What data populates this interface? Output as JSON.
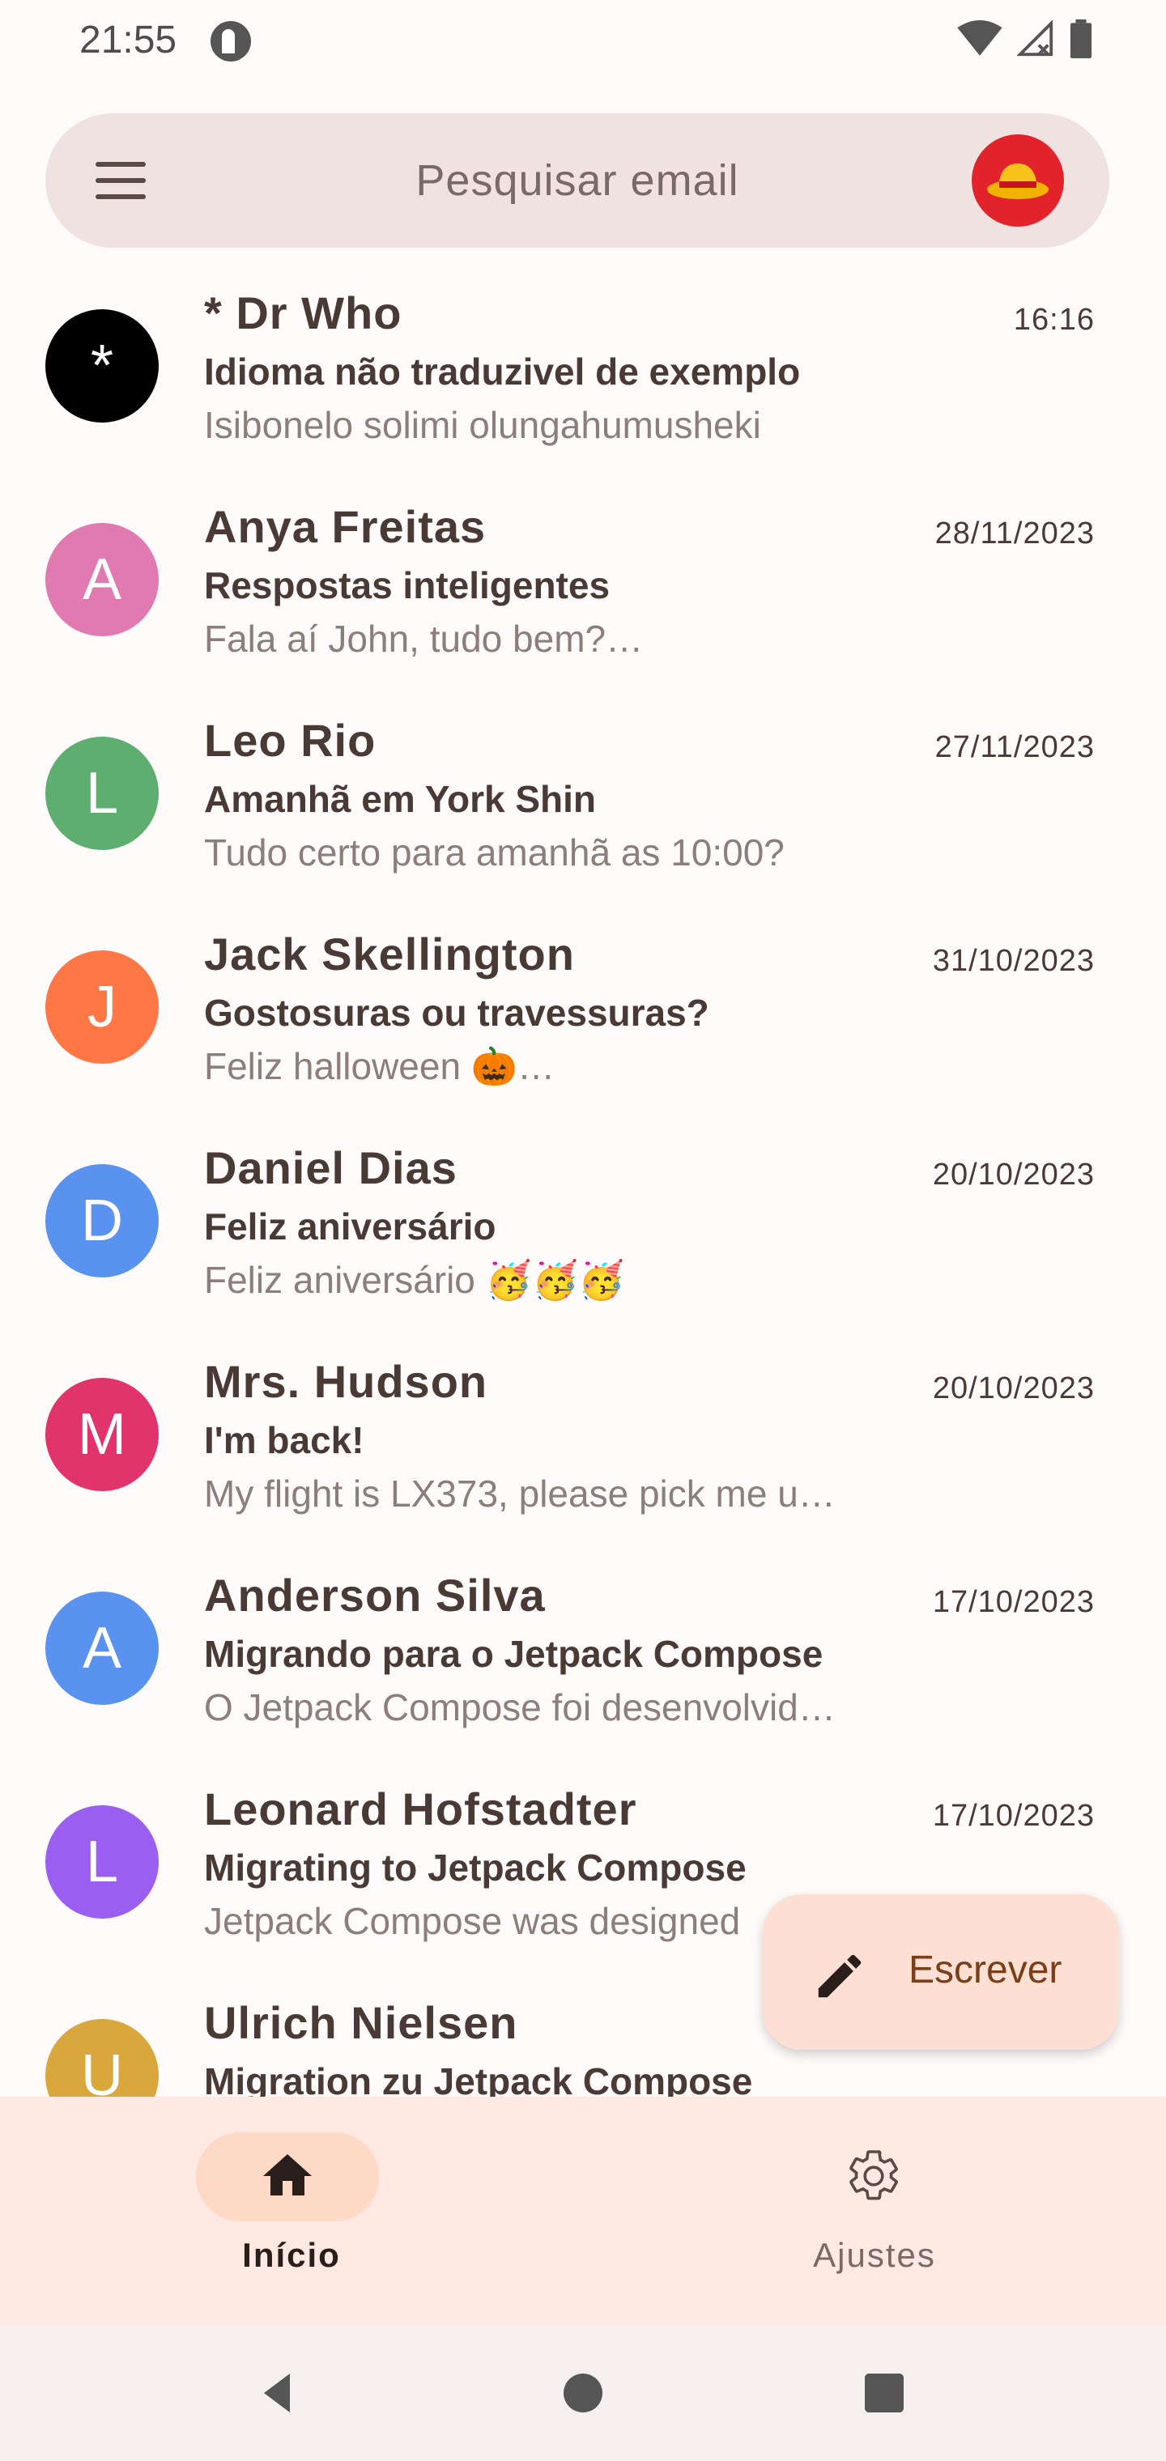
{
  "status": {
    "time": "21:55"
  },
  "search": {
    "placeholder": "Pesquisar email"
  },
  "emails": [
    {
      "sender": "* Dr Who",
      "date": "16:16",
      "subject": "Idioma não traduzivel de exemplo",
      "preview": "Isibonelo solimi olungahumusheki",
      "initial": "*",
      "color": "#000000"
    },
    {
      "sender": "Anya Freitas",
      "date": "28/11/2023",
      "subject": "Respostas inteligentes",
      "preview": "Fala aí John, tudo bem?…",
      "initial": "A",
      "color": "#e27ab2"
    },
    {
      "sender": "Leo Rio",
      "date": "27/11/2023",
      "subject": "Amanhã em York Shin",
      "preview": "Tudo certo para amanhã as 10:00?",
      "initial": "L",
      "color": "#5dae6f"
    },
    {
      "sender": "Jack Skellington",
      "date": "31/10/2023",
      "subject": "Gostosuras ou travessuras?",
      "preview": "Feliz halloween 🎃…",
      "initial": "J",
      "color": "#ff7745"
    },
    {
      "sender": "Daniel Dias",
      "date": "20/10/2023",
      "subject": "Feliz aniversário",
      "preview": "Feliz aniversário 🥳🥳🥳",
      "initial": "D",
      "color": "#5a92f0"
    },
    {
      "sender": "Mrs. Hudson",
      "date": "20/10/2023",
      "subject": "I'm back!",
      "preview": "My flight is LX373, please pick me u…",
      "initial": "M",
      "color": "#e1336c"
    },
    {
      "sender": "Anderson Silva",
      "date": "17/10/2023",
      "subject": "Migrando para o Jetpack Compose",
      "preview": "O Jetpack Compose foi desenvolvid…",
      "initial": "A",
      "color": "#5a92f0"
    },
    {
      "sender": "Leonard Hofstadter",
      "date": "17/10/2023",
      "subject": "Migrating to Jetpack Compose",
      "preview": "Jetpack Compose was designed",
      "initial": "L",
      "color": "#9a5ef0"
    },
    {
      "sender": "Ulrich Nielsen",
      "date": "",
      "subject": "Migration zu Jetpack Compose",
      "preview": "",
      "initial": "U",
      "color": "#d9a73c"
    }
  ],
  "fab": {
    "label": "Escrever"
  },
  "nav": {
    "home_label": "Início",
    "settings_label": "Ajustes"
  },
  "icons": {
    "menu": "menu-icon",
    "avatar": "user-avatar",
    "compose": "pencil-icon",
    "home": "home-icon",
    "settings": "gear-icon"
  }
}
